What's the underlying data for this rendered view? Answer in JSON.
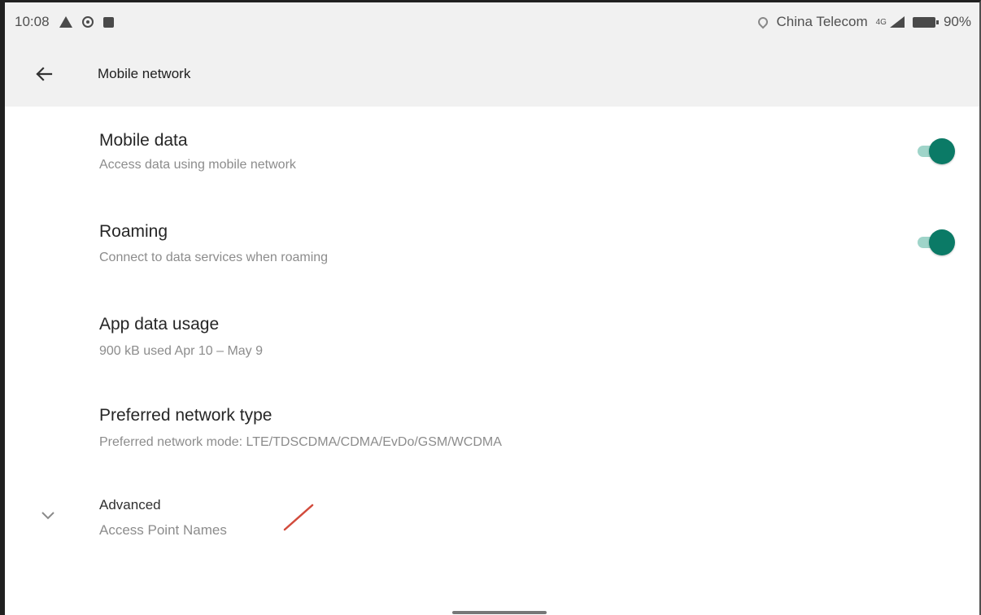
{
  "status_bar": {
    "time": "10:08",
    "left_icons": [
      "alert-icon",
      "target-icon",
      "calendar-icon"
    ],
    "carrier": "China Telecom",
    "network": "4G",
    "battery": "90%"
  },
  "header": {
    "back_icon": "back-arrow-icon",
    "title": "Mobile network"
  },
  "settings": {
    "mobile_data": {
      "title": "Mobile data",
      "subtitle": "Access data using mobile network",
      "enabled": true
    },
    "roaming": {
      "title": "Roaming",
      "subtitle": "Connect to data services when roaming",
      "enabled": true
    },
    "app_data_usage": {
      "title": "App data usage",
      "subtitle": "900 kB used Apr 10 – May 9"
    },
    "preferred_network": {
      "title": "Preferred network type",
      "subtitle": "Preferred network mode: LTE/TDSCDMA/CDMA/EvDo/GSM/WCDMA"
    },
    "advanced": {
      "title": "Advanced",
      "subtitle": "Access Point Names",
      "icon": "chevron-down-icon"
    }
  },
  "colors": {
    "accent": "#0b7a66",
    "track": "#9fd4c9",
    "header_bg": "#f1f1f1"
  }
}
